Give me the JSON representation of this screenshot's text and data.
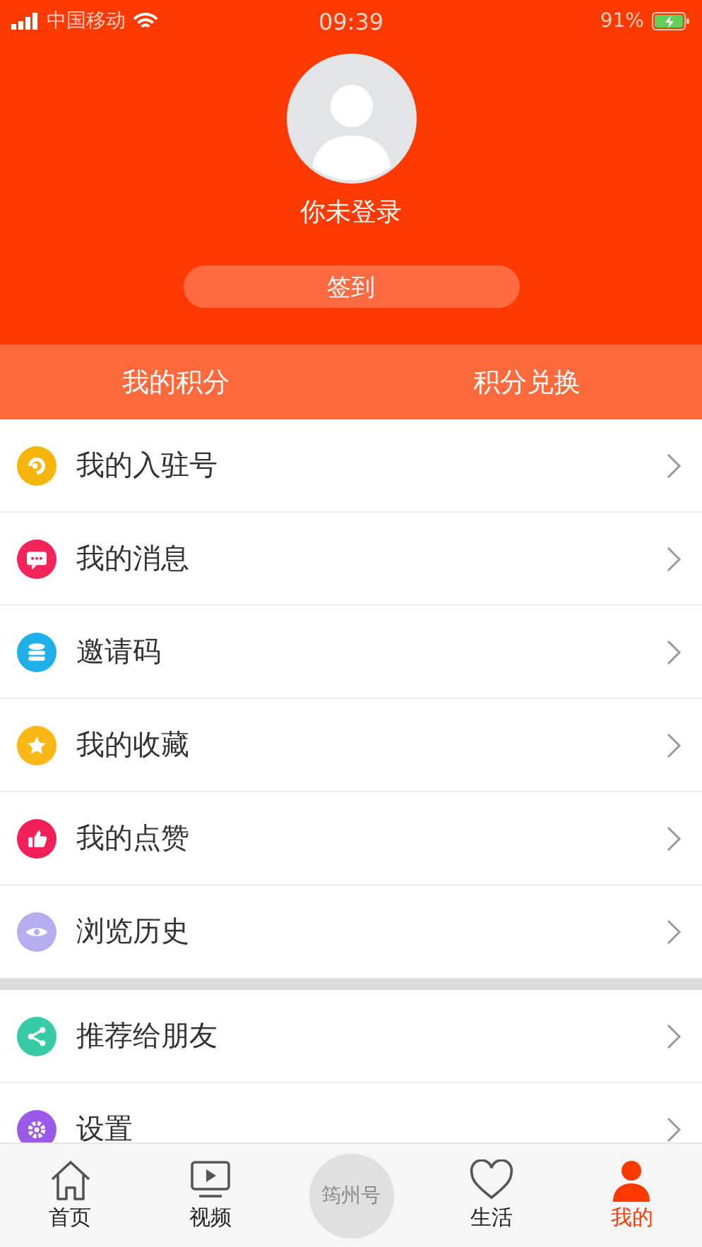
{
  "status_bar": {
    "carrier": "中国移动",
    "time": "09:39",
    "battery": "91%"
  },
  "profile": {
    "name": "你未登录",
    "sign_in": "签到"
  },
  "points_bar": [
    "我的积分",
    "积分兑换"
  ],
  "menu_groups": [
    [
      {
        "label": "我的入驻号",
        "kind": "swirl",
        "color": "#f5b50a"
      },
      {
        "label": "我的消息",
        "kind": "message",
        "color": "#f2245a"
      },
      {
        "label": "邀请码",
        "kind": "stack",
        "color": "#1fb0ea"
      },
      {
        "label": "我的收藏",
        "kind": "star",
        "color": "#fbb716"
      },
      {
        "label": "我的点赞",
        "kind": "thumb",
        "color": "#f21f58"
      },
      {
        "label": "浏览历史",
        "kind": "eye",
        "color": "#b6acf0"
      }
    ],
    [
      {
        "label": "推荐给朋友",
        "kind": "share",
        "color": "#36cba5"
      },
      {
        "label": "设置",
        "kind": "gear",
        "color": "#9a59e6"
      }
    ]
  ],
  "tab_bar": [
    {
      "label": "首页",
      "kind": "home",
      "selected": false
    },
    {
      "label": "视频",
      "kind": "video",
      "selected": false
    },
    {
      "label": "筠州号",
      "kind": "round",
      "selected": false
    },
    {
      "label": "生活",
      "kind": "heart",
      "selected": false
    },
    {
      "label": "我的",
      "kind": "person",
      "selected": true
    }
  ]
}
